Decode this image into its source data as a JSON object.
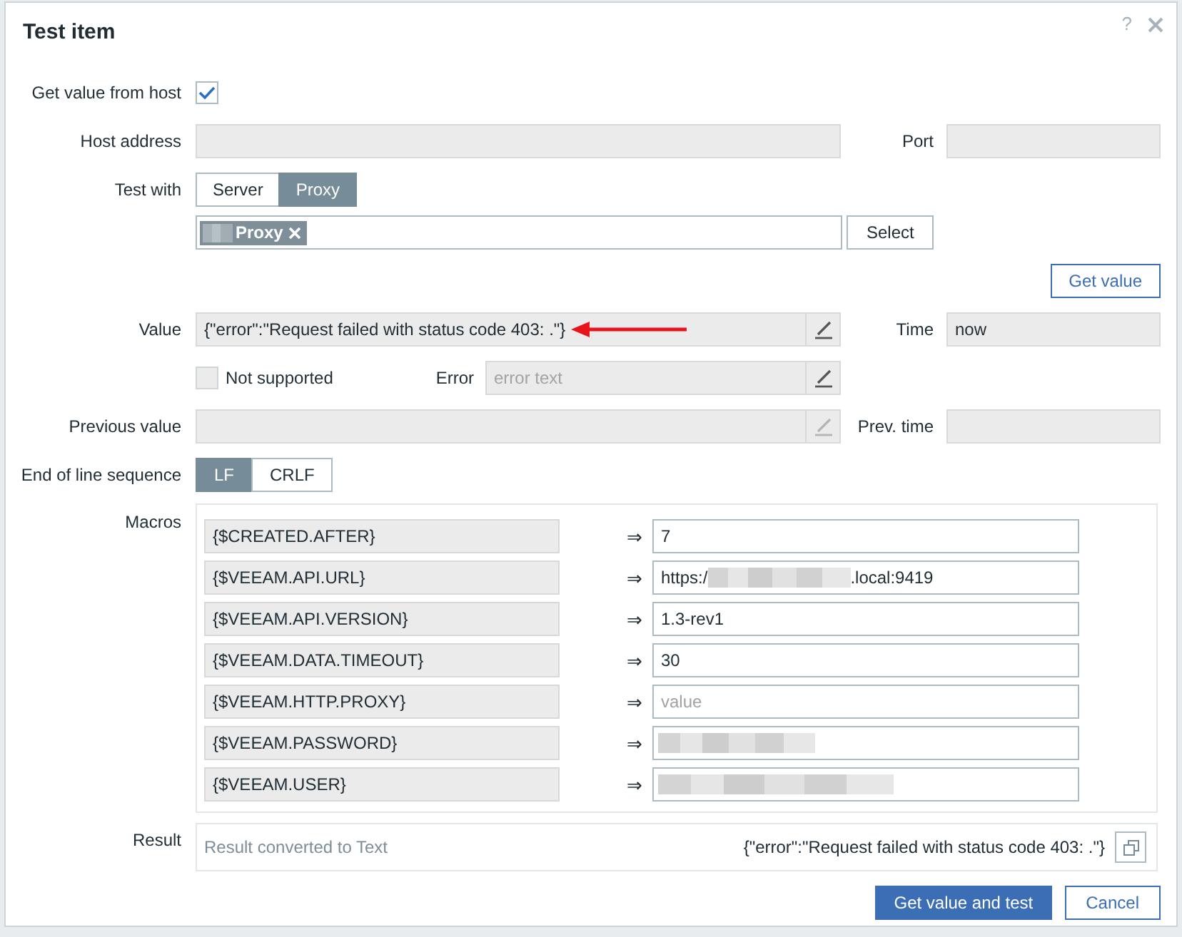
{
  "dialog": {
    "title": "Test item",
    "help": "?"
  },
  "get_value_from_host": {
    "label": "Get value from host",
    "checked": true
  },
  "host_address": {
    "label": "Host address"
  },
  "port": {
    "label": "Port"
  },
  "test_with": {
    "label": "Test with",
    "options": [
      {
        "label": "Server",
        "selected": false
      },
      {
        "label": "Proxy",
        "selected": true
      }
    ]
  },
  "proxy_select": {
    "chips": [
      {
        "label": "Proxy",
        "redacted": true
      }
    ],
    "button": "Select"
  },
  "get_value_button": "Get value",
  "value": {
    "label": "Value",
    "value": "{\"error\":\"Request failed with status code 403: .\"}",
    "annotated": true
  },
  "time": {
    "label": "Time",
    "value": "now"
  },
  "not_supported": {
    "label": "Not supported",
    "checked": false,
    "disabled": true
  },
  "error": {
    "label": "Error",
    "placeholder": "error text"
  },
  "previous_value": {
    "label": "Previous value",
    "edit_disabled": true
  },
  "prev_time": {
    "label": "Prev. time"
  },
  "eol": {
    "label": "End of line sequence",
    "options": [
      {
        "label": "LF",
        "selected": true
      },
      {
        "label": "CRLF",
        "selected": false
      }
    ]
  },
  "macros": {
    "label": "Macros",
    "items": [
      {
        "name": "{$CREATED.AFTER}",
        "arrow": "⇒",
        "kind": "value",
        "value": "7"
      },
      {
        "name": "{$VEEAM.API.URL}",
        "arrow": "⇒",
        "kind": "partly_redacted",
        "value_before": "https:/",
        "value_after": ".local:9419"
      },
      {
        "name": "{$VEEAM.API.VERSION}",
        "arrow": "⇒",
        "kind": "value",
        "value": "1.3-rev1"
      },
      {
        "name": "{$VEEAM.DATA.TIMEOUT}",
        "arrow": "⇒",
        "kind": "value",
        "value": "30"
      },
      {
        "name": "{$VEEAM.HTTP.PROXY}",
        "arrow": "⇒",
        "kind": "empty",
        "placeholder": "value"
      },
      {
        "name": "{$VEEAM.PASSWORD}",
        "arrow": "⇒",
        "kind": "redacted"
      },
      {
        "name": "{$VEEAM.USER}",
        "arrow": "⇒",
        "kind": "redacted"
      }
    ]
  },
  "result": {
    "label": "Result",
    "hint": "Result converted to Text",
    "value": "{\"error\":\"Request failed with status code 403: .\"}"
  },
  "buttons": [
    {
      "label": "Get value and test",
      "kind": "primary"
    },
    {
      "label": "Cancel",
      "kind": "secondary"
    }
  ]
}
